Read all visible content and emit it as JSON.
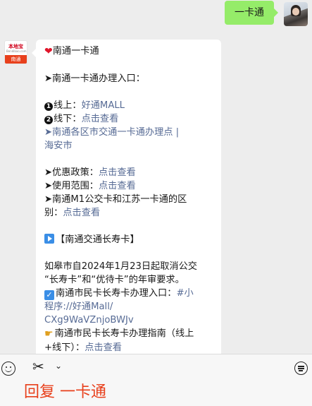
{
  "outgoing_message": {
    "text": "一卡通"
  },
  "incoming_message": {
    "title": "南通一卡通",
    "entry_heading": "➤南通一卡通办理入口：",
    "online": {
      "prefix": "线上：",
      "link": "好通MALL"
    },
    "offline": {
      "prefix": "线下：",
      "link": "点击查看"
    },
    "district_points": {
      "line1": "➤南通各区市交通一卡通办理点 |",
      "line2": "海安市"
    },
    "discount_policy": {
      "prefix": "➤优惠政策：",
      "link": "点击查看"
    },
    "usage_scope": {
      "prefix": "➤使用范围：",
      "link": "点击查看"
    },
    "difference": {
      "line1": "➤南通M1公交卡和江苏一卡通的区",
      "line2_prefix": "别：",
      "line2_link": "点击查看"
    },
    "longevity_card_title": "【南通交通长寿卡】",
    "rugao_notice": {
      "line1": "如皋市自2024年1月23日起取消公交",
      "line2": "“长寿卡”和“优待卡”的年审要求。"
    },
    "civic_card_entry": {
      "line1_prefix": "南通市民卡长寿卡办理入口：",
      "line1_link": "#小",
      "line2": "程序://好通Mall/",
      "line3": "CXg9WaVZnjoBWJv"
    },
    "civic_card_guide": {
      "line1": "南通市民卡长寿卡办理指南（线上",
      "line2_prefix": "+线下）：",
      "line2_link": "点击查看"
    }
  },
  "official_account_avatar": {
    "name_text": "本地宝",
    "sub_text": "Bendibao.com",
    "city_text": "南通"
  },
  "toolbar": {
    "icons": [
      "emoji-icon",
      "scissors-icon",
      "chevron-down-icon",
      "keyboard-icon"
    ],
    "reply_hint": "回复 一卡通"
  },
  "colors": {
    "outgoing_bubble": "#95ec69",
    "link": "#576b95",
    "accent_red": "#e8401c",
    "background": "#ededed"
  }
}
